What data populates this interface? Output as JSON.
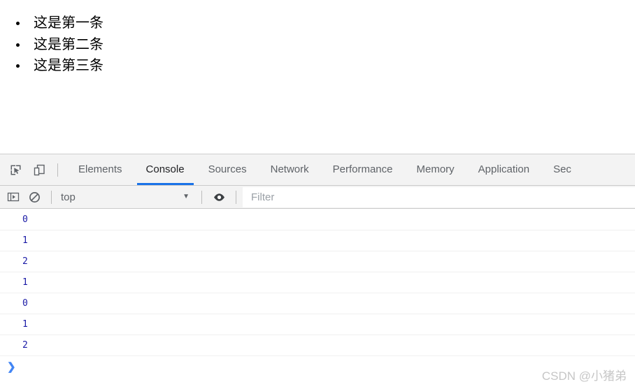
{
  "page": {
    "list_items": [
      "这是第一条",
      "这是第二条",
      "这是第三条"
    ]
  },
  "devtools": {
    "toolbar_icons": [
      {
        "name": "inspect-element-icon",
        "title": "Inspect element"
      },
      {
        "name": "device-toolbar-icon",
        "title": "Toggle device toolbar"
      }
    ],
    "tabs": [
      {
        "label": "Elements",
        "active": false
      },
      {
        "label": "Console",
        "active": true
      },
      {
        "label": "Sources",
        "active": false
      },
      {
        "label": "Network",
        "active": false
      },
      {
        "label": "Performance",
        "active": false
      },
      {
        "label": "Memory",
        "active": false
      },
      {
        "label": "Application",
        "active": false
      },
      {
        "label": "Sec",
        "active": false
      }
    ],
    "active_tab": "Console",
    "accent_color": "#1a73e8",
    "filter_bar": {
      "sidebar_toggle_icon": "console-sidebar-icon",
      "clear_console_icon": "clear-console-icon",
      "context_value": "top",
      "context_caret": "▼",
      "eye_icon": "eye-icon",
      "filter_placeholder": "Filter",
      "filter_value": ""
    },
    "console": {
      "messages": [
        "0",
        "1",
        "2",
        "1",
        "0",
        "1",
        "2"
      ],
      "value_color": "#1a1aa6",
      "prompt_glyph": "❯",
      "prompt_color": "#4285f4"
    }
  },
  "watermark": {
    "text": "CSDN @小猪弟"
  }
}
